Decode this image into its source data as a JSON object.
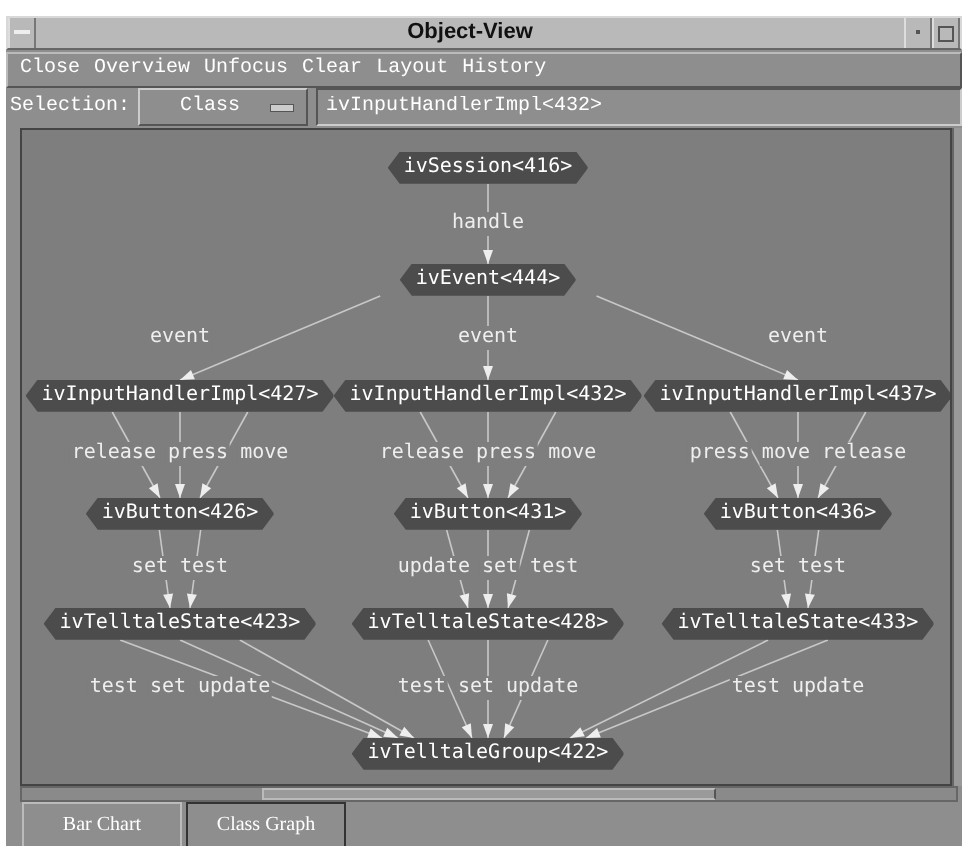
{
  "window": {
    "title": "Object-View"
  },
  "menu": [
    {
      "label": "Close"
    },
    {
      "label": "Overview"
    },
    {
      "label": "Unfocus"
    },
    {
      "label": "Clear"
    },
    {
      "label": "Layout"
    },
    {
      "label": "History"
    }
  ],
  "selection": {
    "label": "Selection:",
    "value": "Class"
  },
  "search": {
    "value": "ivInputHandlerImpl<432>"
  },
  "graph": {
    "levels": [
      {
        "nodes": [
          {
            "label": "ivSession<416>"
          }
        ]
      },
      {
        "edge_labels": [
          [
            "handle"
          ]
        ],
        "nodes": [
          {
            "label": "ivEvent<444>"
          }
        ]
      },
      {
        "edge_labels": [
          [
            "event"
          ],
          [
            "event"
          ],
          [
            "event"
          ]
        ],
        "nodes": [
          {
            "label": "ivInputHandlerImpl<427>"
          },
          {
            "label": "ivInputHandlerImpl<432>"
          },
          {
            "label": "ivInputHandlerImpl<437>"
          }
        ]
      },
      {
        "edge_labels": [
          [
            "release",
            "press",
            "move"
          ],
          [
            "release",
            "press",
            "move"
          ],
          [
            "press",
            "move",
            "release"
          ]
        ],
        "nodes": [
          {
            "label": "ivButton<426>"
          },
          {
            "label": "ivButton<431>"
          },
          {
            "label": "ivButton<436>"
          }
        ]
      },
      {
        "edge_labels": [
          [
            "set",
            "test"
          ],
          [
            "update",
            "set",
            "test"
          ],
          [
            "set",
            "test"
          ]
        ],
        "nodes": [
          {
            "label": "ivTelltaleState<423>"
          },
          {
            "label": "ivTelltaleState<428>"
          },
          {
            "label": "ivTelltaleState<433>"
          }
        ]
      },
      {
        "edge_labels": [
          [
            "test",
            "set",
            "update"
          ],
          [
            "test",
            "set",
            "update"
          ],
          [
            "test",
            "update"
          ]
        ],
        "nodes": [
          {
            "label": "ivTelltaleGroup<422>"
          }
        ]
      }
    ]
  },
  "tabs": [
    {
      "label": "Bar Chart",
      "selected": false
    },
    {
      "label": "Class Graph",
      "selected": true
    }
  ]
}
